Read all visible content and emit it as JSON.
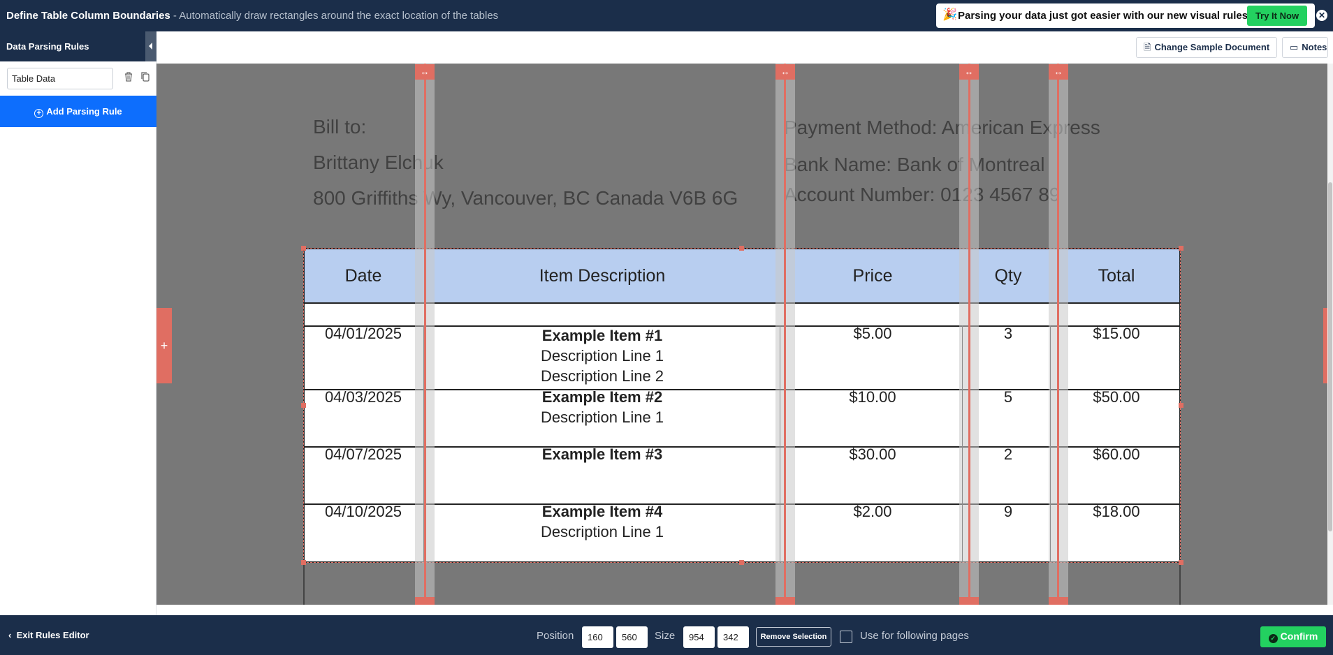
{
  "header": {
    "title": "Define Table Column Boundaries",
    "subtitle": " - Automatically draw rectangles around the exact location of the tables",
    "announcement": {
      "emoji": "🎉",
      "message": "Parsing your data just got easier with our new visual rules editor.",
      "cta_label": "Try It Now"
    },
    "close_glyph": "✕"
  },
  "sidebar": {
    "title": "Data Parsing Rules",
    "rule_name_value": "Table Data",
    "add_rule_label": "Add Parsing Rule",
    "exit_label": "Exit Rules Editor"
  },
  "toolbar": {
    "change_sample_label": "Change Sample Document",
    "notes_label": "Notes"
  },
  "document": {
    "bill_to_label": "Bill to:",
    "customer_name": "Brittany Elchuk",
    "customer_address": "800 Griffiths Wy, Vancouver, BC Canada V6B 6G",
    "payment_method": "Payment Method: American Express",
    "bank_name": "Bank Name: Bank of Montreal",
    "account_number": "Account Number: 0123 4567 89",
    "table": {
      "headers": [
        "Date",
        "Item Description",
        "Price",
        "Qty",
        "Total"
      ],
      "rows": [
        {
          "date": "04/01/2025",
          "item": "Example Item #1",
          "desc1": "Description Line 1",
          "desc2": "Description Line 2",
          "price": "$5.00",
          "qty": "3",
          "total": "$15.00"
        },
        {
          "date": "04/03/2025",
          "item": "Example Item #2",
          "desc1": "Description Line 1",
          "desc2": "",
          "price": "$10.00",
          "qty": "5",
          "total": "$50.00"
        },
        {
          "date": "04/07/2025",
          "item": "Example Item #3",
          "desc1": "",
          "desc2": "",
          "price": "$30.00",
          "qty": "2",
          "total": "$60.00"
        },
        {
          "date": "04/10/2025",
          "item": "Example Item #4",
          "desc1": "Description Line 1",
          "desc2": "",
          "price": "$2.00",
          "qty": "9",
          "total": "$18.00"
        }
      ]
    }
  },
  "bottom": {
    "position_label": "Position",
    "position_x": "160",
    "position_y": "560",
    "size_label": "Size",
    "size_w": "954",
    "size_h": "342",
    "remove_label": "Remove Selection",
    "use_following_label": "Use for following pages",
    "confirm_label": "Confirm"
  },
  "colors": {
    "navy": "#1b2e4a",
    "accent_blue": "#0d6efd",
    "confirm_green": "#23d160",
    "boundary_red": "#e06e62",
    "table_header_blue": "#b8cef0"
  }
}
